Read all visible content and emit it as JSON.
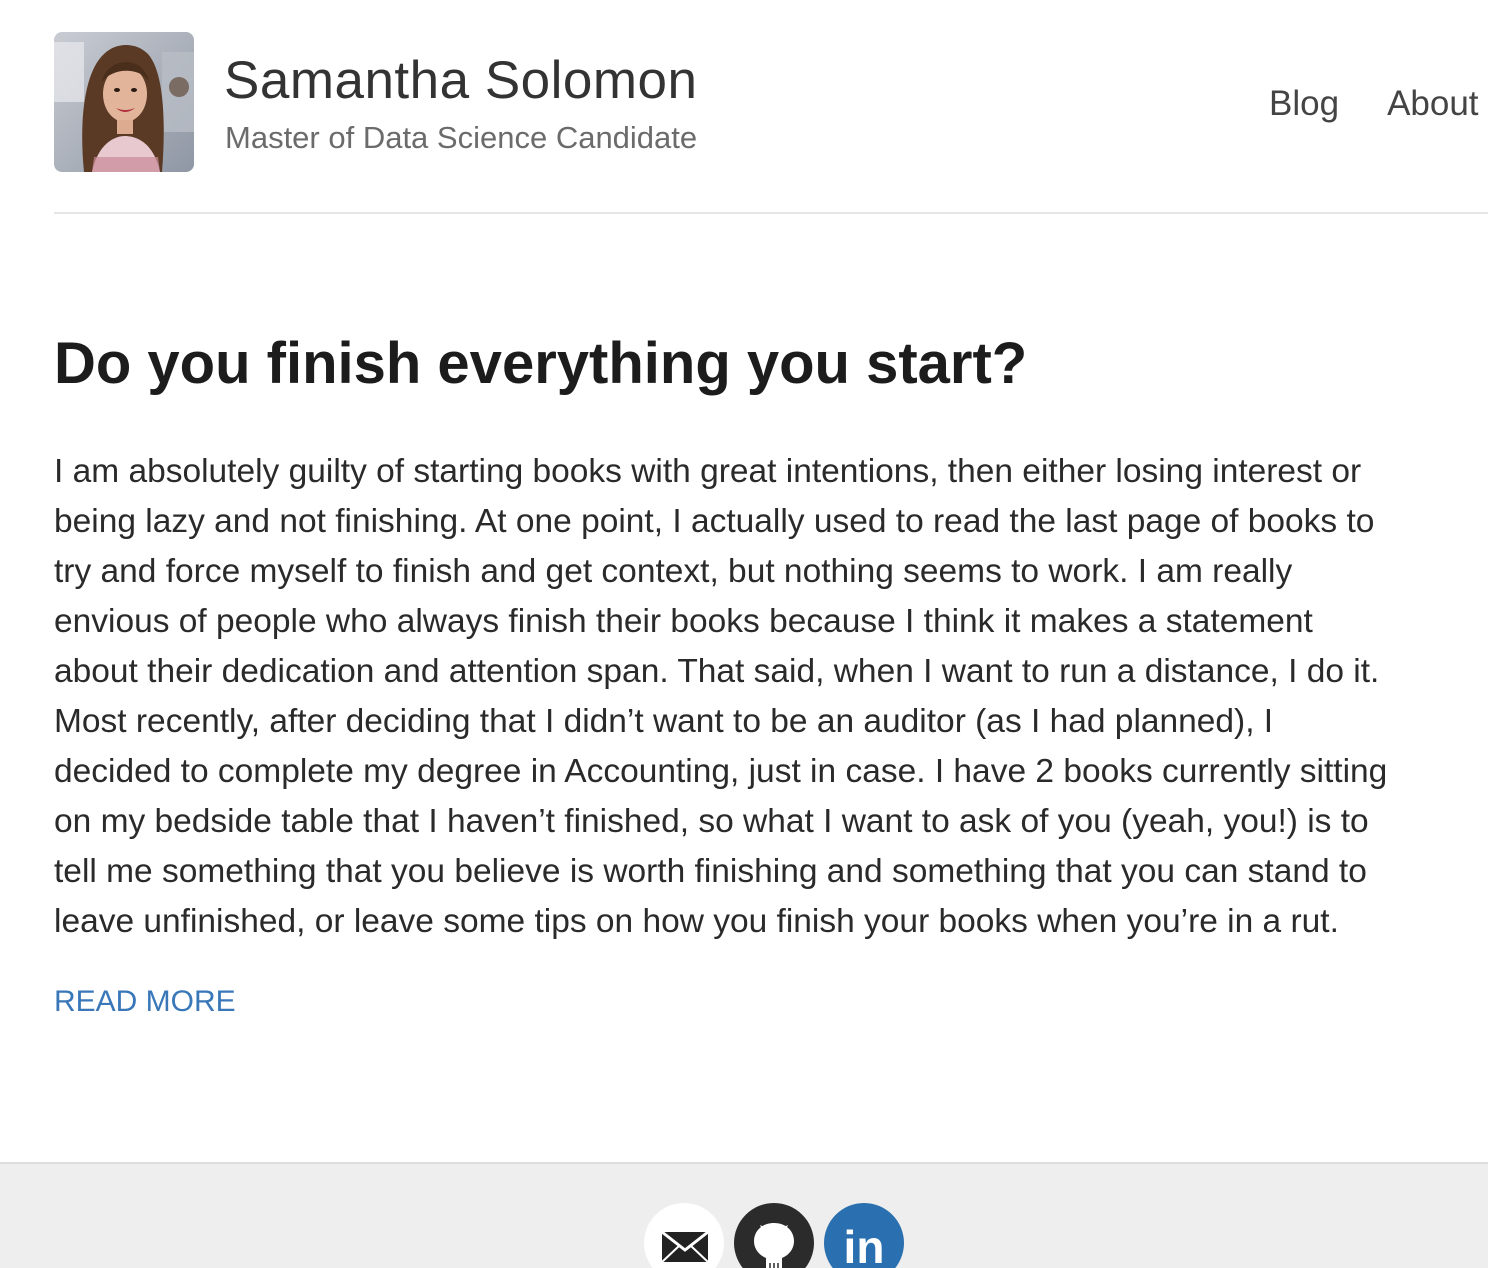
{
  "header": {
    "name": "Samantha Solomon",
    "subtitle": "Master of Data Science Candidate",
    "nav": [
      {
        "label": "Blog"
      },
      {
        "label": "About"
      }
    ]
  },
  "post": {
    "title": "Do you finish everything you start?",
    "body_lines": [
      "I am absolutely guilty of starting books with great intentions, then either losing interest or",
      "being lazy and not finishing. At one point, I actually used to read the last page of books to",
      "try and force myself to finish and get context, but nothing seems to work. I am really",
      "envious of people who always finish their books because I think it makes a statement",
      "about their dedication and attention span. That said, when I want to run a distance, I do it.",
      "Most recently, after deciding that I didn’t want to be an auditor (as I had planned), I",
      "decided to complete my degree in Accounting, just in case. I have 2 books currently sitting",
      "on my bedside table that I haven’t finished, so what I want to ask of you (yeah, you!) is to",
      "tell me something that you believe is worth finishing and something that you can stand to",
      "leave unfinished, or leave some tips on how you finish your books when you’re in a rut."
    ],
    "read_more_label": "READ MORE"
  },
  "footer": {
    "social": [
      {
        "icon": "email-icon"
      },
      {
        "icon": "github-icon"
      },
      {
        "icon": "linkedin-icon",
        "glyph": "in"
      }
    ]
  },
  "colors": {
    "link": "#3a77b8",
    "linkedin": "#2a6fb0",
    "github": "#2b2b2b",
    "footer_bg": "#eeeeee"
  }
}
